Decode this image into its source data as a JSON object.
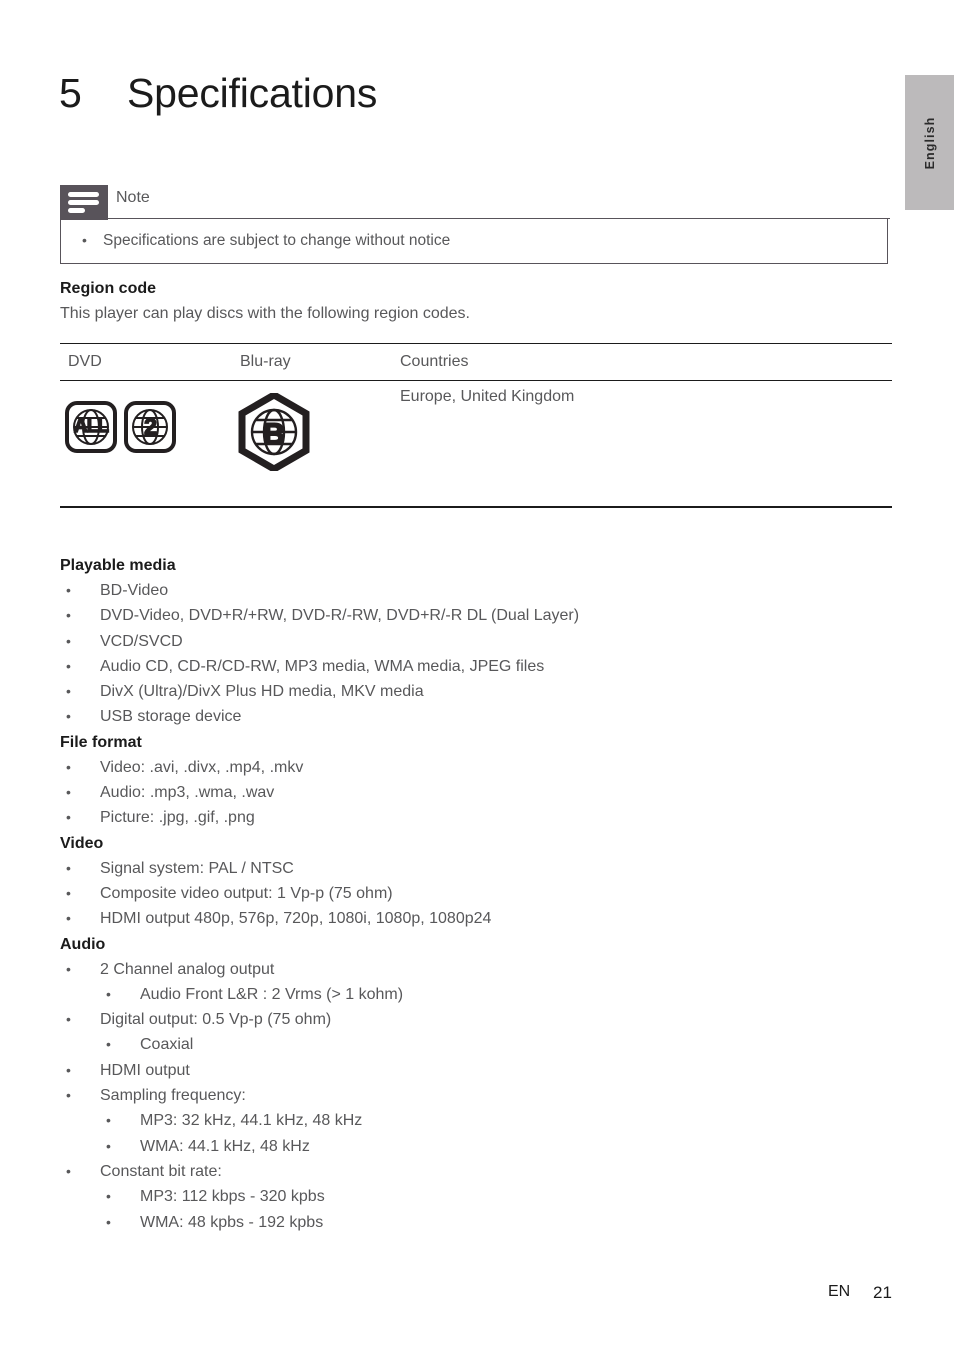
{
  "language_tab": {
    "label": "English"
  },
  "header": {
    "chapter_number": "5",
    "title": "Specifications"
  },
  "note": {
    "icon": "note-lines-icon",
    "label": "Note",
    "bullet": "•",
    "items": [
      "Specifications are subject to change without notice"
    ]
  },
  "region_code": {
    "heading": "Region code",
    "description": "This player can play discs with the following region codes.",
    "columns": [
      "DVD",
      "Blu-ray",
      "Countries"
    ],
    "row": {
      "dvd_codes": [
        "ALL",
        "2"
      ],
      "bluray_code": "B",
      "countries": "Europe, United Kingdom"
    }
  },
  "sections": [
    {
      "heading": "Playable media",
      "items": [
        {
          "level": 1,
          "text": "BD-Video"
        },
        {
          "level": 1,
          "text": "DVD-Video, DVD+R/+RW, DVD-R/-RW, DVD+R/-R DL (Dual Layer)"
        },
        {
          "level": 1,
          "text": "VCD/SVCD"
        },
        {
          "level": 1,
          "text": "Audio CD, CD-R/CD-RW, MP3 media, WMA media, JPEG files"
        },
        {
          "level": 1,
          "text": "DivX (Ultra)/DivX Plus HD media, MKV media"
        },
        {
          "level": 1,
          "text": "USB storage device"
        }
      ]
    },
    {
      "heading": "File format",
      "items": [
        {
          "level": 1,
          "text": "Video: .avi, .divx, .mp4, .mkv"
        },
        {
          "level": 1,
          "text": "Audio: .mp3, .wma, .wav"
        },
        {
          "level": 1,
          "text": "Picture: .jpg, .gif, .png"
        }
      ]
    },
    {
      "heading": "Video",
      "items": [
        {
          "level": 1,
          "text": "Signal system: PAL / NTSC"
        },
        {
          "level": 1,
          "text": "Composite video output: 1 Vp-p (75 ohm)"
        },
        {
          "level": 1,
          "text": "HDMI output 480p, 576p, 720p, 1080i, 1080p, 1080p24"
        }
      ]
    },
    {
      "heading": "Audio",
      "items": [
        {
          "level": 1,
          "text": "2 Channel analog output"
        },
        {
          "level": 2,
          "text": "Audio Front L&R : 2 Vrms (> 1 kohm)"
        },
        {
          "level": 1,
          "text": "Digital output: 0.5 Vp-p (75 ohm)"
        },
        {
          "level": 2,
          "text": "Coaxial"
        },
        {
          "level": 1,
          "text": "HDMI output"
        },
        {
          "level": 1,
          "text": "Sampling frequency:"
        },
        {
          "level": 2,
          "text": "MP3: 32 kHz, 44.1 kHz, 48 kHz"
        },
        {
          "level": 2,
          "text": "WMA: 44.1 kHz, 48 kHz"
        },
        {
          "level": 1,
          "text": "Constant bit rate:"
        },
        {
          "level": 2,
          "text": "MP3: 112 kbps - 320 kpbs"
        },
        {
          "level": 2,
          "text": "WMA: 48 kpbs - 192 kpbs"
        }
      ]
    }
  ],
  "bullet_char": "•",
  "footer": {
    "language_code": "EN",
    "page_number": "21"
  },
  "colors": {
    "note_icon_bg": "#58535a",
    "tab_bg": "#bcbabb",
    "body_text": "#58585a",
    "heading_text": "#1b1b1b"
  }
}
